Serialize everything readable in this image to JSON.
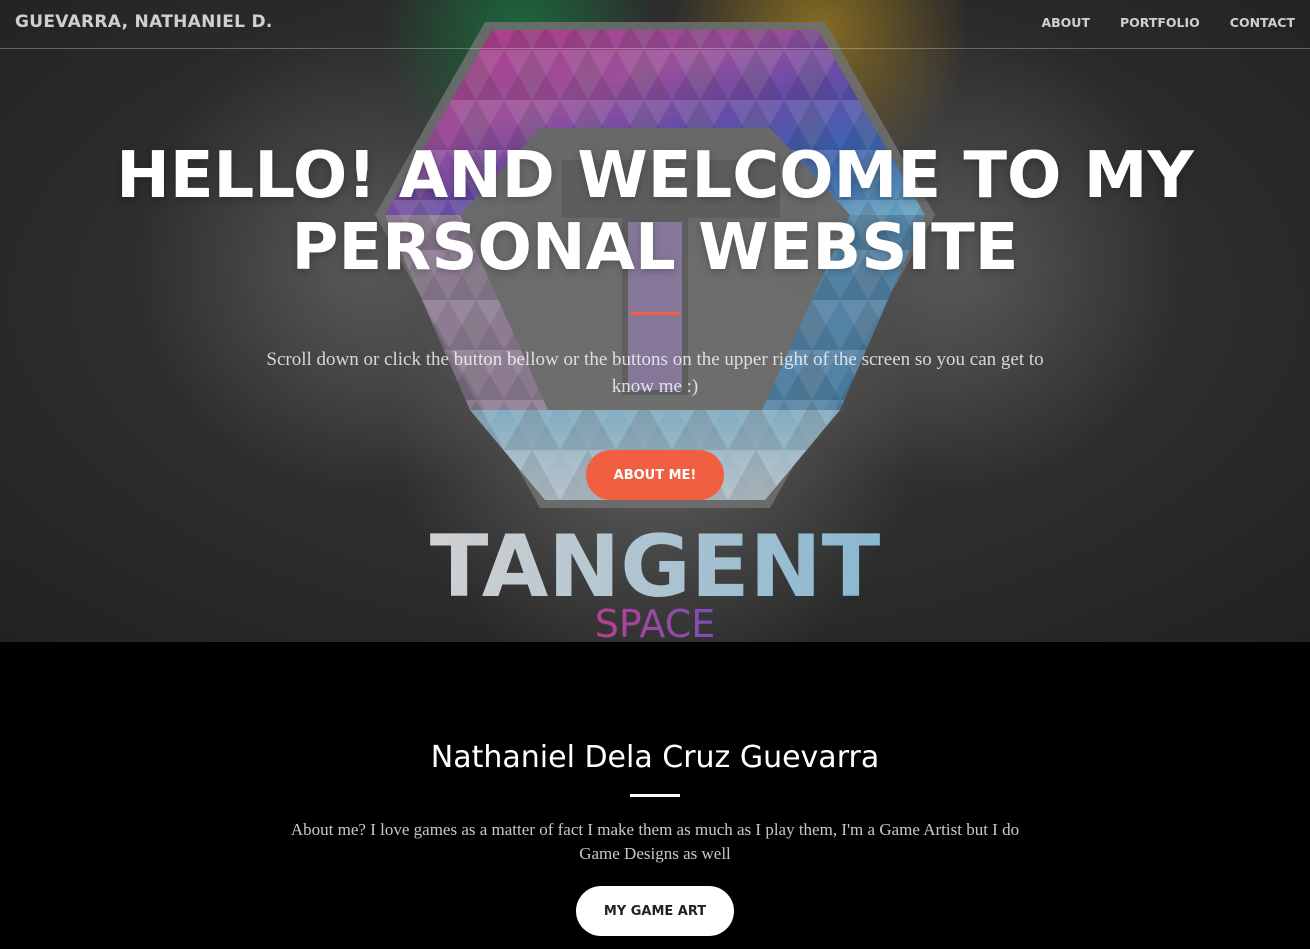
{
  "navbar": {
    "brand": "GUEVARRA, NATHANIEL D.",
    "links": [
      {
        "label": "ABOUT"
      },
      {
        "label": "PORTFOLIO"
      },
      {
        "label": "CONTACT"
      }
    ]
  },
  "hero": {
    "title": "HELLO! AND WELCOME TO MY PERSONAL WEBSITE",
    "subtitle": "Scroll down or click the button bellow or the buttons on the upper right of the screen so you can get to know me :)",
    "button_label": "ABOUT ME!",
    "logo": {
      "word": "TANGENT",
      "subword": "SPACE"
    }
  },
  "about": {
    "name": "Nathaniel Dela Cruz Guevarra",
    "text": "About me? I love games as a matter of fact I make them as much as I play them, I'm a Game Artist but I do Game Designs as well",
    "button_label": "MY GAME ART"
  },
  "colors": {
    "accent": "#f05f40",
    "background": "#000000"
  }
}
